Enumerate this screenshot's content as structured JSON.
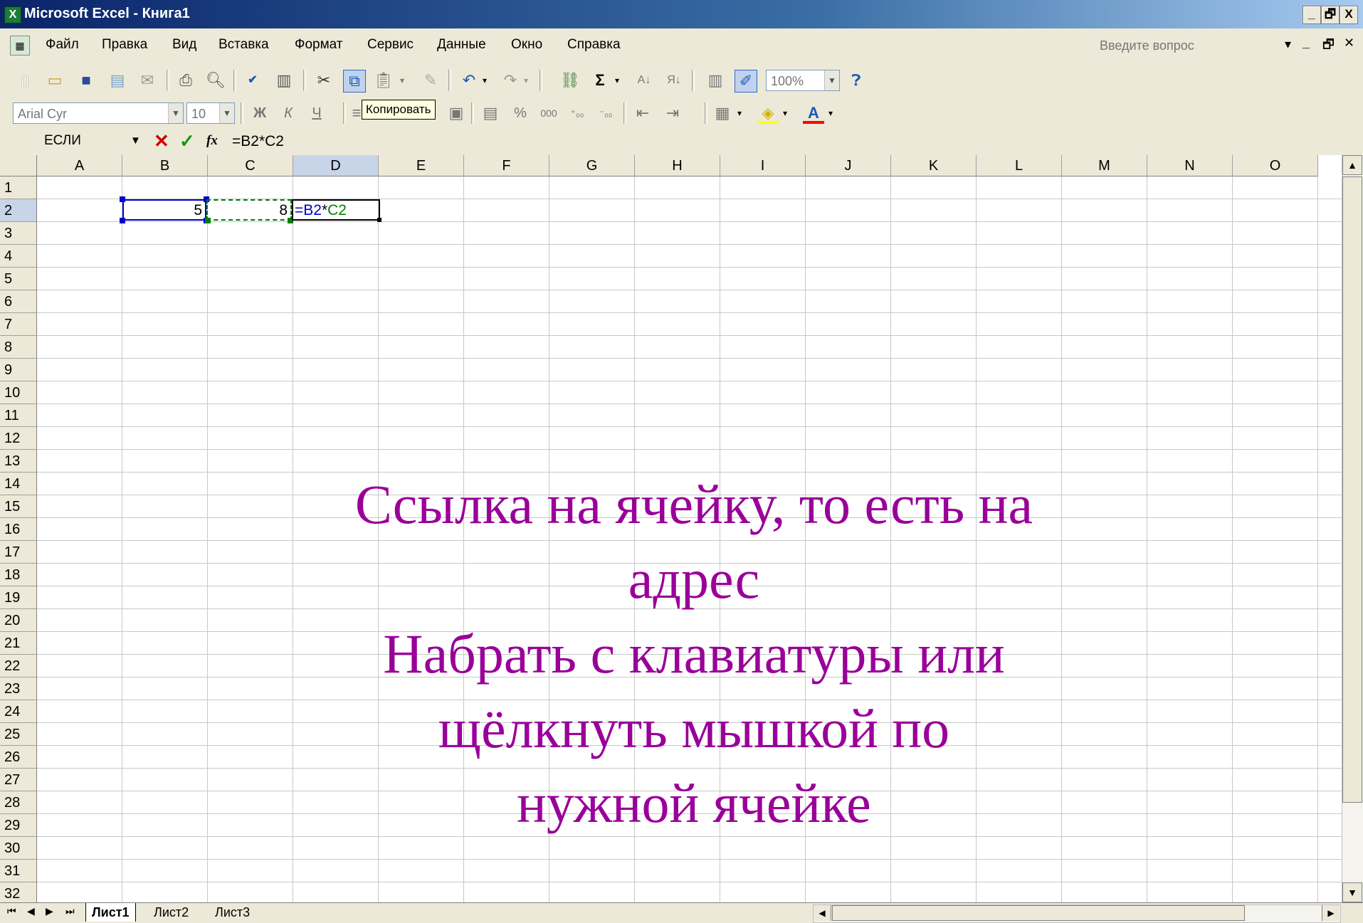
{
  "window": {
    "title": "Microsoft Excel - Книга1",
    "app_icon": "excel-icon",
    "buttons": [
      "_",
      "🗗",
      "X"
    ]
  },
  "menubar": {
    "items": [
      "Файл",
      "Правка",
      "Вид",
      "Вставка",
      "Формат",
      "Сервис",
      "Данные",
      "Окно",
      "Справка"
    ],
    "help_placeholder": "Введите вопрос",
    "doc_buttons": [
      "▾",
      "_",
      "🗗",
      "✕"
    ]
  },
  "standard_toolbar": {
    "zoom": "100%"
  },
  "formatting_toolbar": {
    "font": "Arial Cyr",
    "size": "10",
    "bold": "Ж",
    "italic": "К",
    "underline": "Ч",
    "tooltip": "Копировать",
    "percent": "%",
    "thousands": "000",
    "font_color_letter": "A"
  },
  "formula_bar": {
    "name_box": "ЕСЛИ",
    "fx": "fx",
    "formula": "=B2*C2"
  },
  "grid": {
    "columns": [
      "A",
      "B",
      "C",
      "D",
      "E",
      "F",
      "G",
      "H",
      "I",
      "J",
      "K",
      "L",
      "M",
      "N",
      "O"
    ],
    "rows": [
      "1",
      "2",
      "3",
      "4",
      "5",
      "6",
      "7",
      "8",
      "9",
      "10",
      "11",
      "12",
      "13",
      "14",
      "15",
      "16",
      "17",
      "18",
      "19",
      "20",
      "21",
      "22",
      "23",
      "24",
      "25",
      "26",
      "27",
      "28",
      "29",
      "30",
      "31",
      "32"
    ],
    "cells": {
      "B2": "5",
      "C2": "8",
      "D2_ref1": "=B2",
      "D2_op": "*",
      "D2_ref2": "C2"
    },
    "ref_colors": {
      "B2": "#0000cc",
      "C2": "#008000"
    }
  },
  "sheet_tabs": [
    "Лист1",
    "Лист2",
    "Лист3"
  ],
  "overlay": {
    "line1": "Ссылка на ячейку, то есть на",
    "line2": "адрес",
    "line3": "Набрать с клавиатуры или",
    "line4": "щёлкнуть мышкой по",
    "line5": "нужной ячейке"
  }
}
